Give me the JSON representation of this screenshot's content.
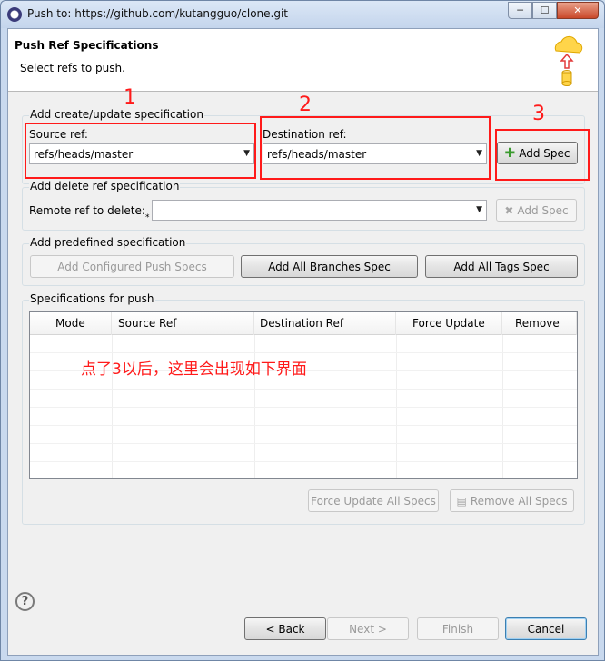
{
  "window": {
    "title": "Push to: https://github.com/kutangguo/clone.git",
    "controls": {
      "minimize": "─",
      "maximize": "☐",
      "close": "✕"
    }
  },
  "header": {
    "title": "Push Ref Specifications",
    "subtitle": "Select refs to push.",
    "icon": "push-cloud-icon"
  },
  "create_update": {
    "group_label": "Add create/update specification",
    "source_label": "Source ref:",
    "source_value": "refs/heads/master",
    "destination_label": "Destination ref:",
    "destination_value": "refs/heads/master",
    "add_spec_label": "Add Spec"
  },
  "delete_spec": {
    "group_label": "Add delete ref specification",
    "remote_label": "Remote ref to delete:",
    "remote_value": "",
    "add_spec_label": "Add Spec"
  },
  "predefined": {
    "group_label": "Add predefined specification",
    "configured_label": "Add Configured Push Specs",
    "branches_label": "Add All Branches Spec",
    "tags_label": "Add All Tags Spec"
  },
  "specs_for_push": {
    "group_label": "Specifications for push",
    "columns": [
      "Mode",
      "Source Ref",
      "Destination Ref",
      "Force Update",
      "Remove"
    ],
    "rows": [],
    "force_update_all_label": "Force Update All Specs",
    "remove_all_label": "Remove All Specs"
  },
  "footer": {
    "help_label": "?",
    "back_label": "< Back",
    "next_label": "Next >",
    "finish_label": "Finish",
    "cancel_label": "Cancel"
  },
  "annotations": {
    "marker_1": "1",
    "marker_2": "2",
    "marker_3": "3",
    "note": "点了3以后，这里会出现如下界面",
    "color": "#ff1a1a"
  }
}
